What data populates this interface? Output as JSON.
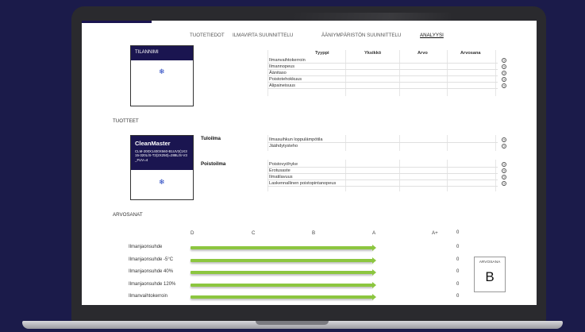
{
  "nav": {
    "tabs": [
      "TUOTETIEDOT",
      "ILMAVIRTA SUUNNITTELU",
      "ÄÄNIYMPÄRISTÖN SUUNNITTELU",
      "ANALYYSI"
    ],
    "active": "ANALYYSI"
  },
  "room_card": {
    "title": "TILANNIMI"
  },
  "table_header": {
    "type": "Tyyppi",
    "unit": "Yksikkö",
    "value": "Arvo",
    "grade": "Arvosana"
  },
  "room_rows": [
    "Ilmanvaihtokerroin",
    "Ilmannopeus",
    "Äänitaso",
    "Poistotehokkuus",
    "Alipaineisuus"
  ],
  "products_title": "TUOTTEET",
  "product_card": {
    "name": "CleanMaster",
    "desc": "CLM-200X1400X560-B1UV2(1X315-320L/S-T2(2X250)=288L/S-V3_FUV=4"
  },
  "supply": {
    "label": "Tuloilma",
    "rows": [
      "Ilmasuihkun loppulämpötila",
      "Jäähdytysteho"
    ]
  },
  "exhaust": {
    "label": "Poistoilma",
    "rows": [
      "Poistovyöhyke",
      "Erotusaste",
      "Ilmatilavuus",
      "Laskennallinen poistopintanopeus"
    ]
  },
  "grades_title": "ARVOSANAT",
  "grade_scale": [
    "D",
    "C",
    "B",
    "A",
    "A+"
  ],
  "grade_scale_score": "0",
  "grade_rows": [
    {
      "label": "Ilmanjaonsuhde",
      "level": 0.74,
      "score": "0"
    },
    {
      "label": "Ilmanjaonsuhde -5°C",
      "level": 0.74,
      "score": "0"
    },
    {
      "label": "Ilmanjaonsuhde 40%",
      "level": 0.74,
      "score": "0"
    },
    {
      "label": "Ilmanjaonsuhde 120%",
      "level": 0.74,
      "score": "0"
    },
    {
      "label": "Ilmanvaihtokerroin",
      "level": 0.74,
      "score": "0"
    }
  ],
  "overall": {
    "label": "ARVOSANA",
    "grade": "B"
  },
  "info_icon": "info-circle-icon",
  "colors": {
    "accent": "#1a1550",
    "bar": "#8cc63f",
    "background": "#1b1b4a"
  }
}
